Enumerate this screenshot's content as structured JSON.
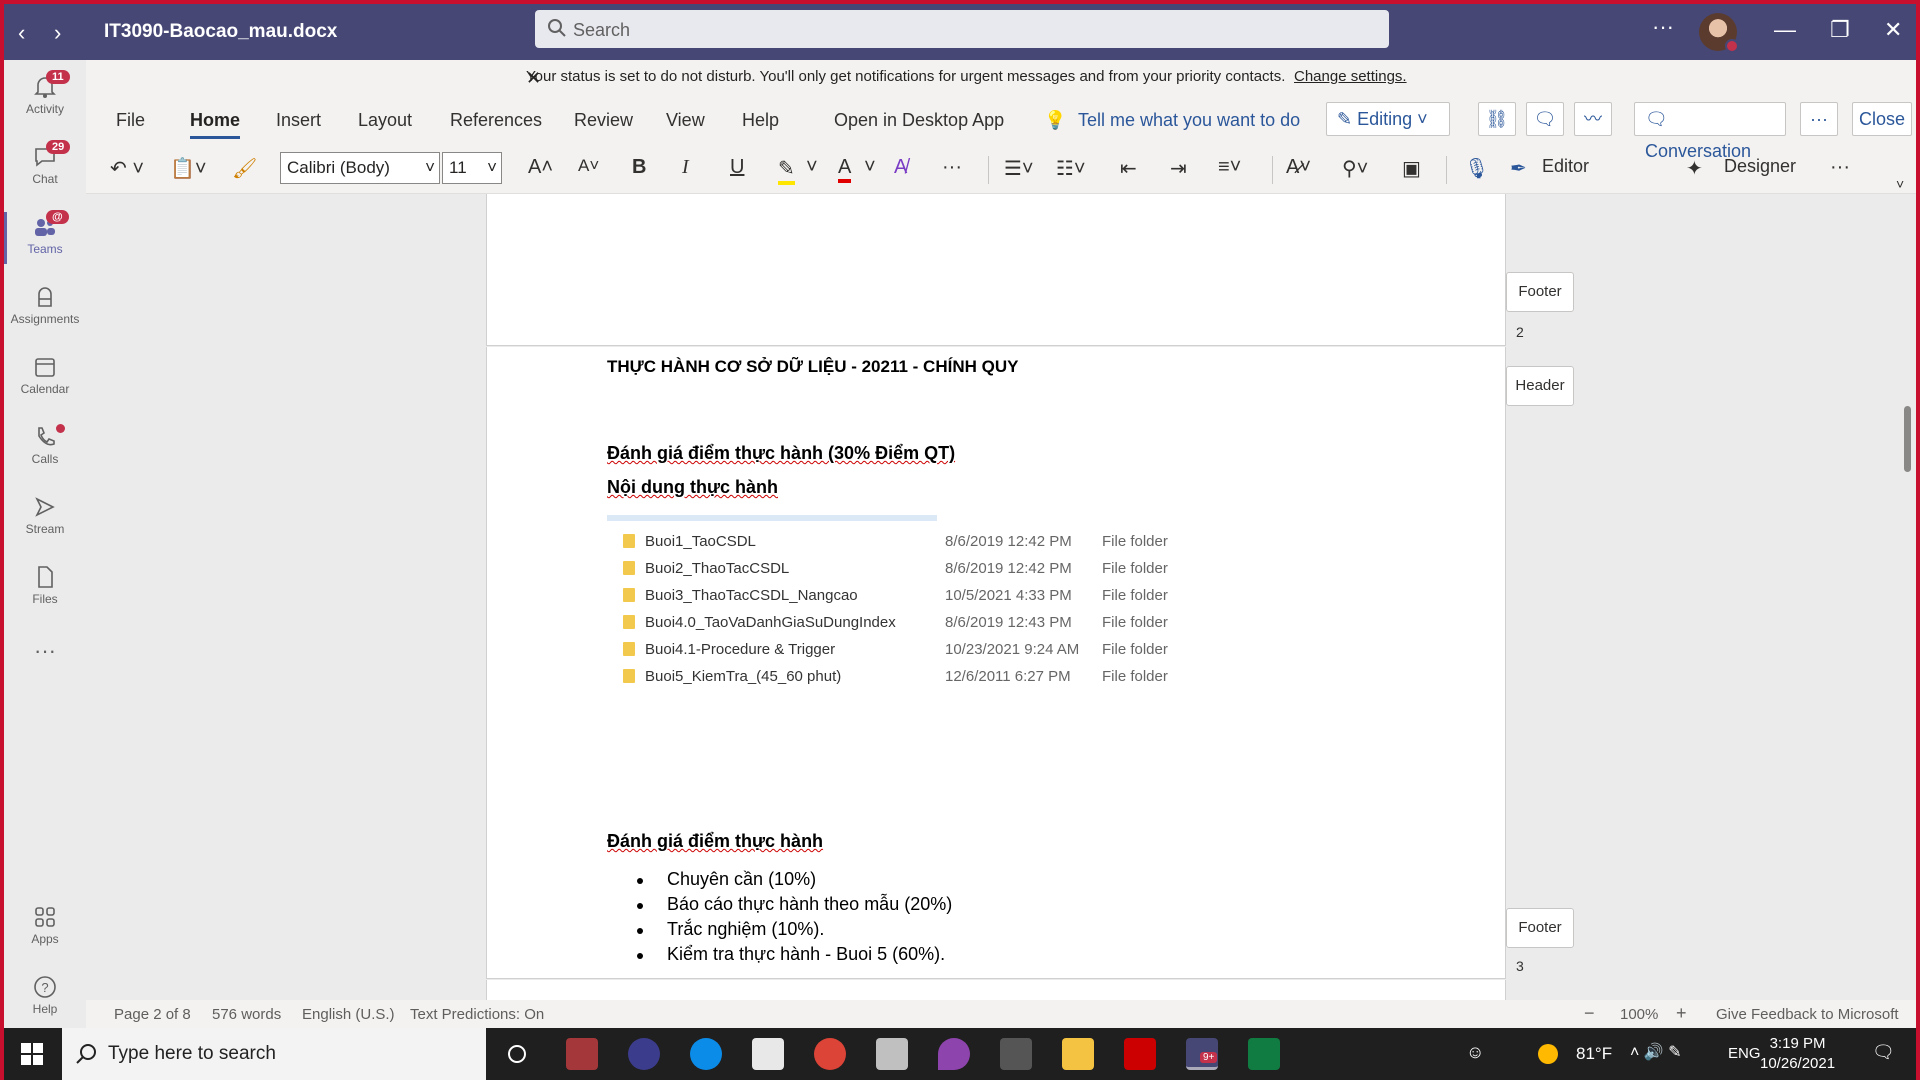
{
  "titlebar": {
    "title": "IT3090-Baocao_mau.docx",
    "search_placeholder": "Search",
    "more": "···"
  },
  "rail": {
    "items": [
      {
        "label": "Activity",
        "badge": "11"
      },
      {
        "label": "Chat",
        "badge": "29"
      },
      {
        "label": "Teams",
        "badge": "@"
      },
      {
        "label": "Assignments"
      },
      {
        "label": "Calendar"
      },
      {
        "label": "Calls"
      },
      {
        "label": "Stream"
      },
      {
        "label": "Files"
      },
      {
        "label": "···"
      },
      {
        "label": "Apps"
      },
      {
        "label": "Help"
      }
    ]
  },
  "notice": {
    "text": "Your status is set to do not disturb. You'll only get notifications for urgent messages and from your priority contacts.",
    "link": "Change settings."
  },
  "ribbon": {
    "tabs": [
      "File",
      "Home",
      "Insert",
      "Layout",
      "References",
      "Review",
      "View",
      "Help",
      "Open in Desktop App"
    ],
    "tell_me": "Tell me what you want to do",
    "editing": "Editing",
    "conversation": "Conversation",
    "more": "···",
    "close": "Close",
    "font": "Calibri (Body)",
    "size": "11",
    "editor": "Editor",
    "designer": "Designer"
  },
  "document": {
    "heading": "THỰC HÀNH CƠ SỞ DỮ LIỆU - 20211 - CHÍNH QUY",
    "section1": "Đánh giá điểm thực hành (30% Điểm QT)",
    "section2": "Nội dung thực hành",
    "folders": [
      {
        "name": "Buoi1_TaoCSDL",
        "date": "8/6/2019 12:42 PM",
        "type": "File folder"
      },
      {
        "name": "Buoi2_ThaoTacCSDL",
        "date": "8/6/2019 12:42 PM",
        "type": "File folder"
      },
      {
        "name": "Buoi3_ThaoTacCSDL_Nangcao",
        "date": "10/5/2021 4:33 PM",
        "type": "File folder"
      },
      {
        "name": "Buoi4.0_TaoVaDanhGiaSuDungIndex",
        "date": "8/6/2019 12:43 PM",
        "type": "File folder"
      },
      {
        "name": "Buoi4.1-Procedure & Trigger",
        "date": "10/23/2021 9:24 AM",
        "type": "File folder"
      },
      {
        "name": "Buoi5_KiemTra_(45_60 phut)",
        "date": "12/6/2011 6:27 PM",
        "type": "File folder"
      }
    ],
    "section3": "Đánh giá điểm thực hành",
    "bullets": [
      "Chuyên cần (10%)",
      "Báo cáo thực hành theo mẫu (20%)",
      "Trắc nghiệm (10%).",
      "Kiểm tra thực hành - Buoi 5 (60%)."
    ],
    "footer_tag": "Footer",
    "header_tag": "Header",
    "page_num_2": "2",
    "page_num_3": "3"
  },
  "status": {
    "page": "Page 2 of 8",
    "words": "576 words",
    "language": "English (U.S.)",
    "predictions": "Text Predictions: On",
    "zoom_minus": "−",
    "zoom": "100%",
    "zoom_plus": "+",
    "feedback": "Give Feedback to Microsoft"
  },
  "taskbar": {
    "search": "Type here to search",
    "temp": "81°F",
    "lang": "ENG",
    "time": "3:19 PM",
    "date": "10/26/2021",
    "teams_badge": "9+"
  }
}
